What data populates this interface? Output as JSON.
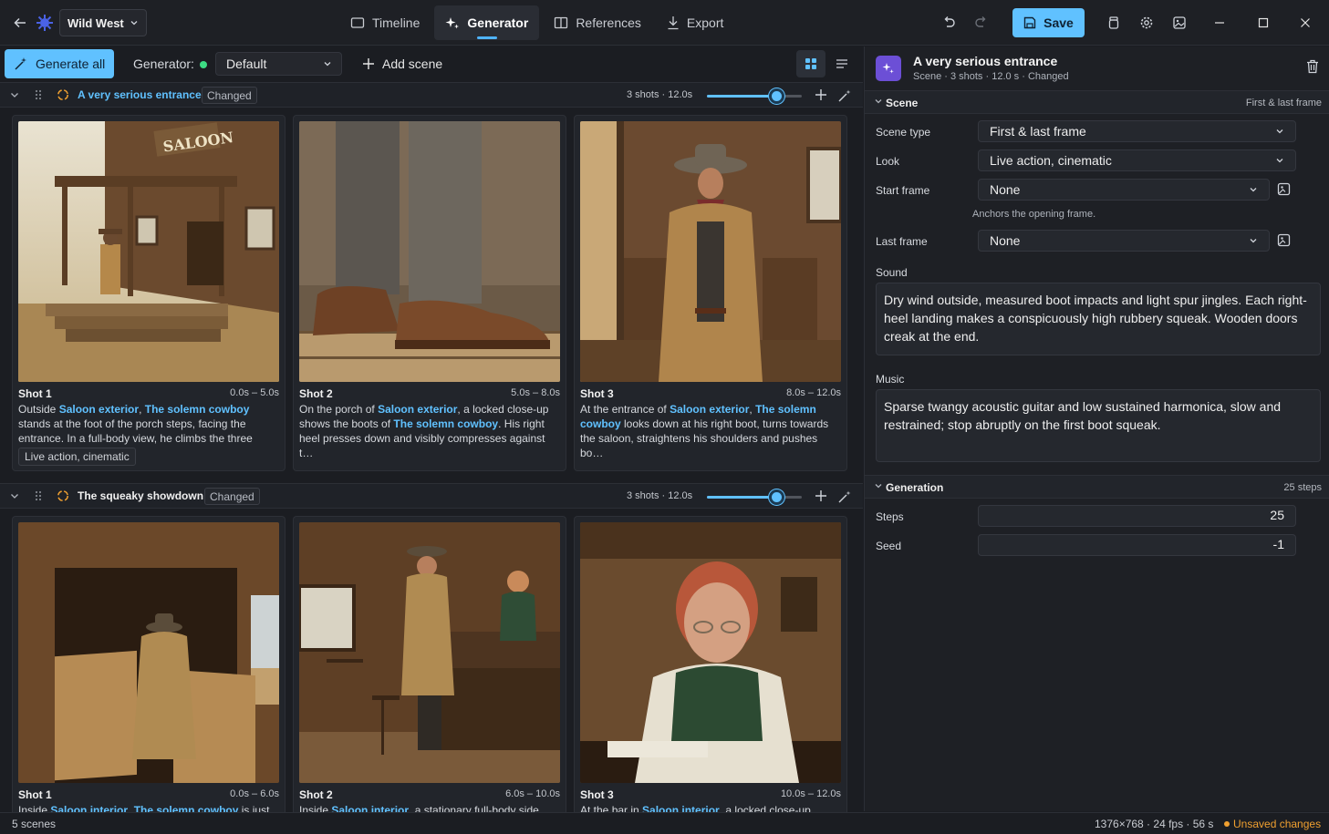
{
  "app": {
    "project_name": "Wild West",
    "save_label": "Save",
    "nav_tabs": [
      {
        "label": "Timeline",
        "icon": "timeline-icon"
      },
      {
        "label": "Generator",
        "icon": "sparkle-icon",
        "active": true
      },
      {
        "label": "References",
        "icon": "book-icon"
      },
      {
        "label": "Export",
        "icon": "export-icon"
      }
    ],
    "accent_color": "#60c1ff"
  },
  "toolbar": {
    "generate_all_label": "Generate all",
    "generator_label": "Generator:",
    "generator_value": "Default",
    "add_scene_label": "Add scene"
  },
  "scenes": [
    {
      "title": "A very serious entrance",
      "badge": "Changed",
      "meta": "3 shots · 12.0s",
      "selected": true,
      "slider_fraction": 0.74,
      "shots": [
        {
          "label": "Shot 1",
          "time": "0.0s – 5.0s",
          "desc_parts": [
            [
              "Outside ",
              false
            ],
            [
              "Saloon exterior",
              true
            ],
            [
              ", ",
              false
            ],
            [
              "The solemn cowboy",
              true
            ],
            [
              " stands at the foot of the porch steps, facing the entrance. In a full-body view, he climbs the three steps with…",
              false
            ]
          ],
          "tag": "Live action, cinematic"
        },
        {
          "label": "Shot 2",
          "time": "5.0s – 8.0s",
          "desc_parts": [
            [
              "On the porch of ",
              false
            ],
            [
              "Saloon exterior",
              true
            ],
            [
              ", a locked close-up shows the boots of ",
              false
            ],
            [
              "The solemn cowboy",
              true
            ],
            [
              ". His right heel presses down and visibly compresses against t…",
              false
            ]
          ]
        },
        {
          "label": "Shot 3",
          "time": "8.0s – 12.0s",
          "desc_parts": [
            [
              "At the entrance of ",
              false
            ],
            [
              "Saloon exterior",
              true
            ],
            [
              ", ",
              false
            ],
            [
              "The solemn cowboy",
              true
            ],
            [
              " looks down at his right boot, turns towards the saloon, straightens his shoulders and pushes bo…",
              false
            ]
          ]
        }
      ]
    },
    {
      "title": "The squeaky showdown",
      "badge": "Changed",
      "meta": "3 shots · 12.0s",
      "selected": false,
      "slider_fraction": 0.74,
      "shots": [
        {
          "label": "Shot 1",
          "time": "0.0s – 6.0s",
          "desc_parts": [
            [
              "Inside ",
              false
            ],
            [
              "Saloon interior",
              true
            ],
            [
              ", ",
              false
            ],
            [
              "The solemn cowboy",
              true
            ],
            [
              " is just",
              false
            ]
          ]
        },
        {
          "label": "Shot 2",
          "time": "6.0s – 10.0s",
          "desc_parts": [
            [
              "Inside ",
              false
            ],
            [
              "Saloon interior",
              true
            ],
            [
              ", a stationary full-body side view",
              false
            ]
          ]
        },
        {
          "label": "Shot 3",
          "time": "10.0s – 12.0s",
          "desc_parts": [
            [
              "At the bar in ",
              false
            ],
            [
              "Saloon interior",
              true
            ],
            [
              ", a locked close-up shows",
              false
            ]
          ]
        }
      ]
    }
  ],
  "panel": {
    "title": "A very serious entrance",
    "subtitle": "Scene · 3 shots · 12.0 s · Changed",
    "scene_section": {
      "title": "Scene",
      "right": "First & last frame",
      "scene_type_label": "Scene type",
      "scene_type_value": "First & last frame",
      "look_label": "Look",
      "look_value": "Live action, cinematic",
      "start_frame_label": "Start frame",
      "start_frame_value": "None",
      "start_frame_hint": "Anchors the opening frame.",
      "last_frame_label": "Last frame",
      "last_frame_value": "None",
      "sound_label": "Sound",
      "sound_value": "Dry wind outside, measured boot impacts and light spur jingles. Each right-heel landing makes a conspicuously high rubbery squeak. Wooden doors creak at the end.",
      "music_label": "Music",
      "music_value": "Sparse twangy acoustic guitar and low sustained harmonica, slow and restrained; stop abruptly on the first boot squeak."
    },
    "generation_section": {
      "title": "Generation",
      "right": "25 steps",
      "steps_label": "Steps",
      "steps_value": "25",
      "seed_label": "Seed",
      "seed_value": "-1"
    }
  },
  "status": {
    "left": "5 scenes",
    "middle": "1376×768 · 24 fps · 56 s",
    "right": "Unsaved changes"
  }
}
